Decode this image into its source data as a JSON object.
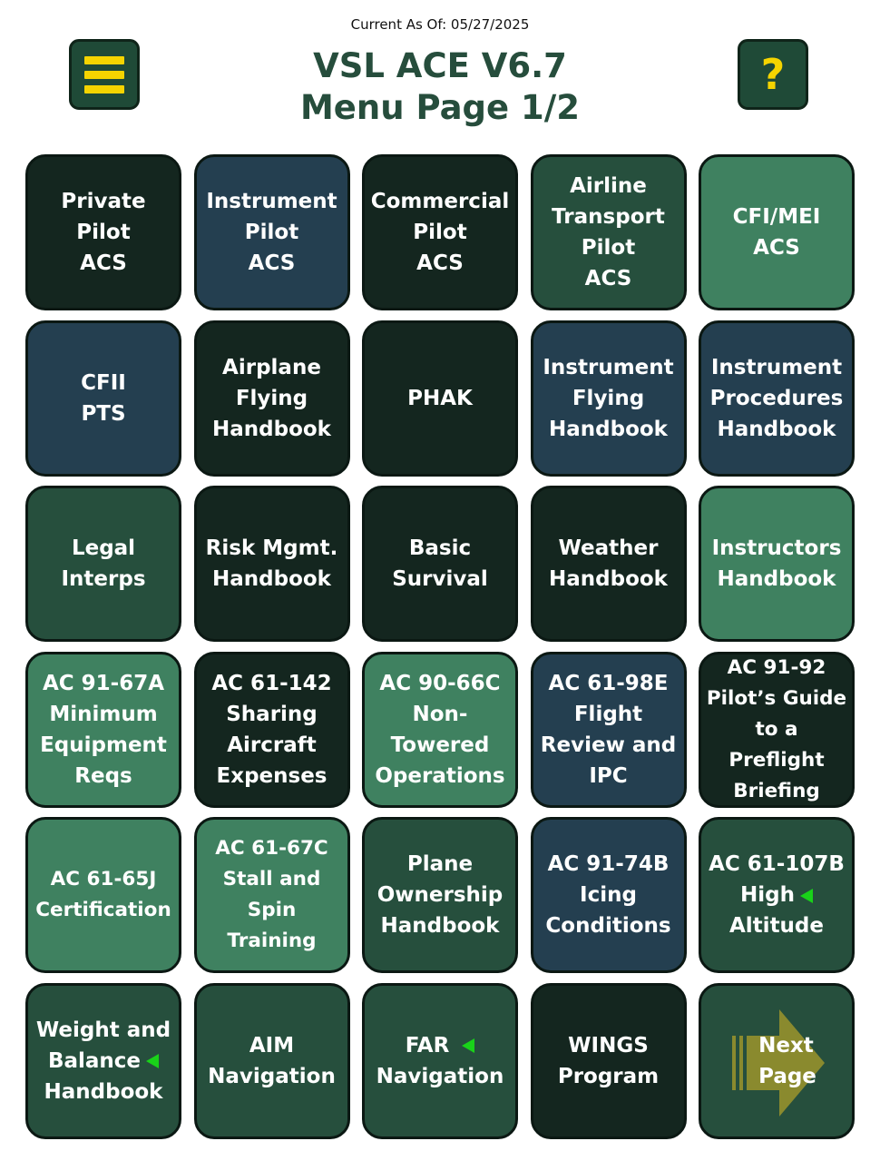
{
  "header": {
    "updated": "Current As Of: 05/27/2025",
    "title_line1": "VSL ACE V6.7",
    "title_line2": "Menu Page 1/2",
    "help_label": "?"
  },
  "colors": {
    "title": "#264d3c",
    "accent_yellow": "#f5d400",
    "tile_dark": "#14261f",
    "tile_blue": "#243f50",
    "tile_green": "#264f3d",
    "tile_light": "#3f8160",
    "marker_green": "#19d219",
    "next_arrow": "#8a8a2e"
  },
  "tiles": [
    "Private\nPilot\nACS",
    "Instrument\nPilot\nACS",
    "Commercial\nPilot\nACS",
    "Airline\nTransport\nPilot\nACS",
    "CFI/MEI\nACS",
    "CFII\nPTS",
    "Airplane\nFlying\nHandbook",
    "PHAK",
    "Instrument\nFlying\nHandbook",
    "Instrument\nProcedures\nHandbook",
    "Legal\nInterps",
    "Risk Mgmt.\nHandbook",
    "Basic\nSurvival",
    "Weather\nHandbook",
    "Instructors\nHandbook",
    "AC 91-67A\nMinimum\nEquipment\nReqs",
    "AC 61-142\nSharing\nAircraft\nExpenses",
    "AC 90-66C\nNon-\nTowered\nOperations",
    "AC 61-98E\nFlight\nReview and\nIPC",
    "AC 91-92\nPilot’s Guide\nto a Preflight\nBriefing",
    "AC 61-65J\nCertification",
    "AC 61-67C\nStall and\nSpin Training",
    "Plane\nOwnership\nHandbook",
    "AC 91-74B\nIcing\nConditions",
    "AC 61-107B\nHigh",
    "Altitude",
    "Weight and\nBalance",
    "Handbook",
    "AIM\nNavigation",
    "FAR",
    "Navigation",
    "WINGS\nProgram",
    "Next\nPage"
  ],
  "icons": {
    "menu": "hamburger-menu-icon",
    "help": "question-mark-icon",
    "new_marker": "green-triangle-left-icon",
    "next": "right-arrow-icon"
  }
}
